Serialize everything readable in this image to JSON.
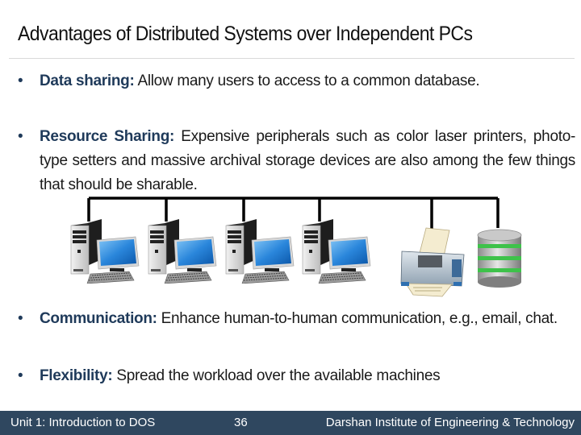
{
  "slide": {
    "title": "Advantages of Distributed Systems over Independent PCs",
    "bullets": [
      {
        "term": "Data sharing:",
        "text": " Allow many users to access to a common database."
      },
      {
        "term": "Resource Sharing:",
        "text": " Expensive peripherals such as color laser printers, photo-type setters and massive archival storage devices are also among the few things that should be sharable."
      },
      {
        "term": "Communication:",
        "text": " Enhance human-to-human communication, e.g., email, chat."
      },
      {
        "term": "Flexibility:",
        "text": " Spread the workload over the available machines"
      }
    ],
    "bullet_glyph": "•",
    "diagram": {
      "nodes": [
        {
          "type": "computer-icon"
        },
        {
          "type": "computer-icon"
        },
        {
          "type": "computer-icon"
        },
        {
          "type": "computer-icon"
        },
        {
          "type": "printer-icon"
        },
        {
          "type": "database-icon"
        }
      ]
    }
  },
  "footer": {
    "unit": "Unit 1: Introduction to DOS",
    "page": "36",
    "institute": "Darshan Institute of Engineering & Technology"
  },
  "colors": {
    "accent": "#1f3a5a",
    "footer_bg": "#2f475f",
    "rule": "#d9d9d9"
  }
}
